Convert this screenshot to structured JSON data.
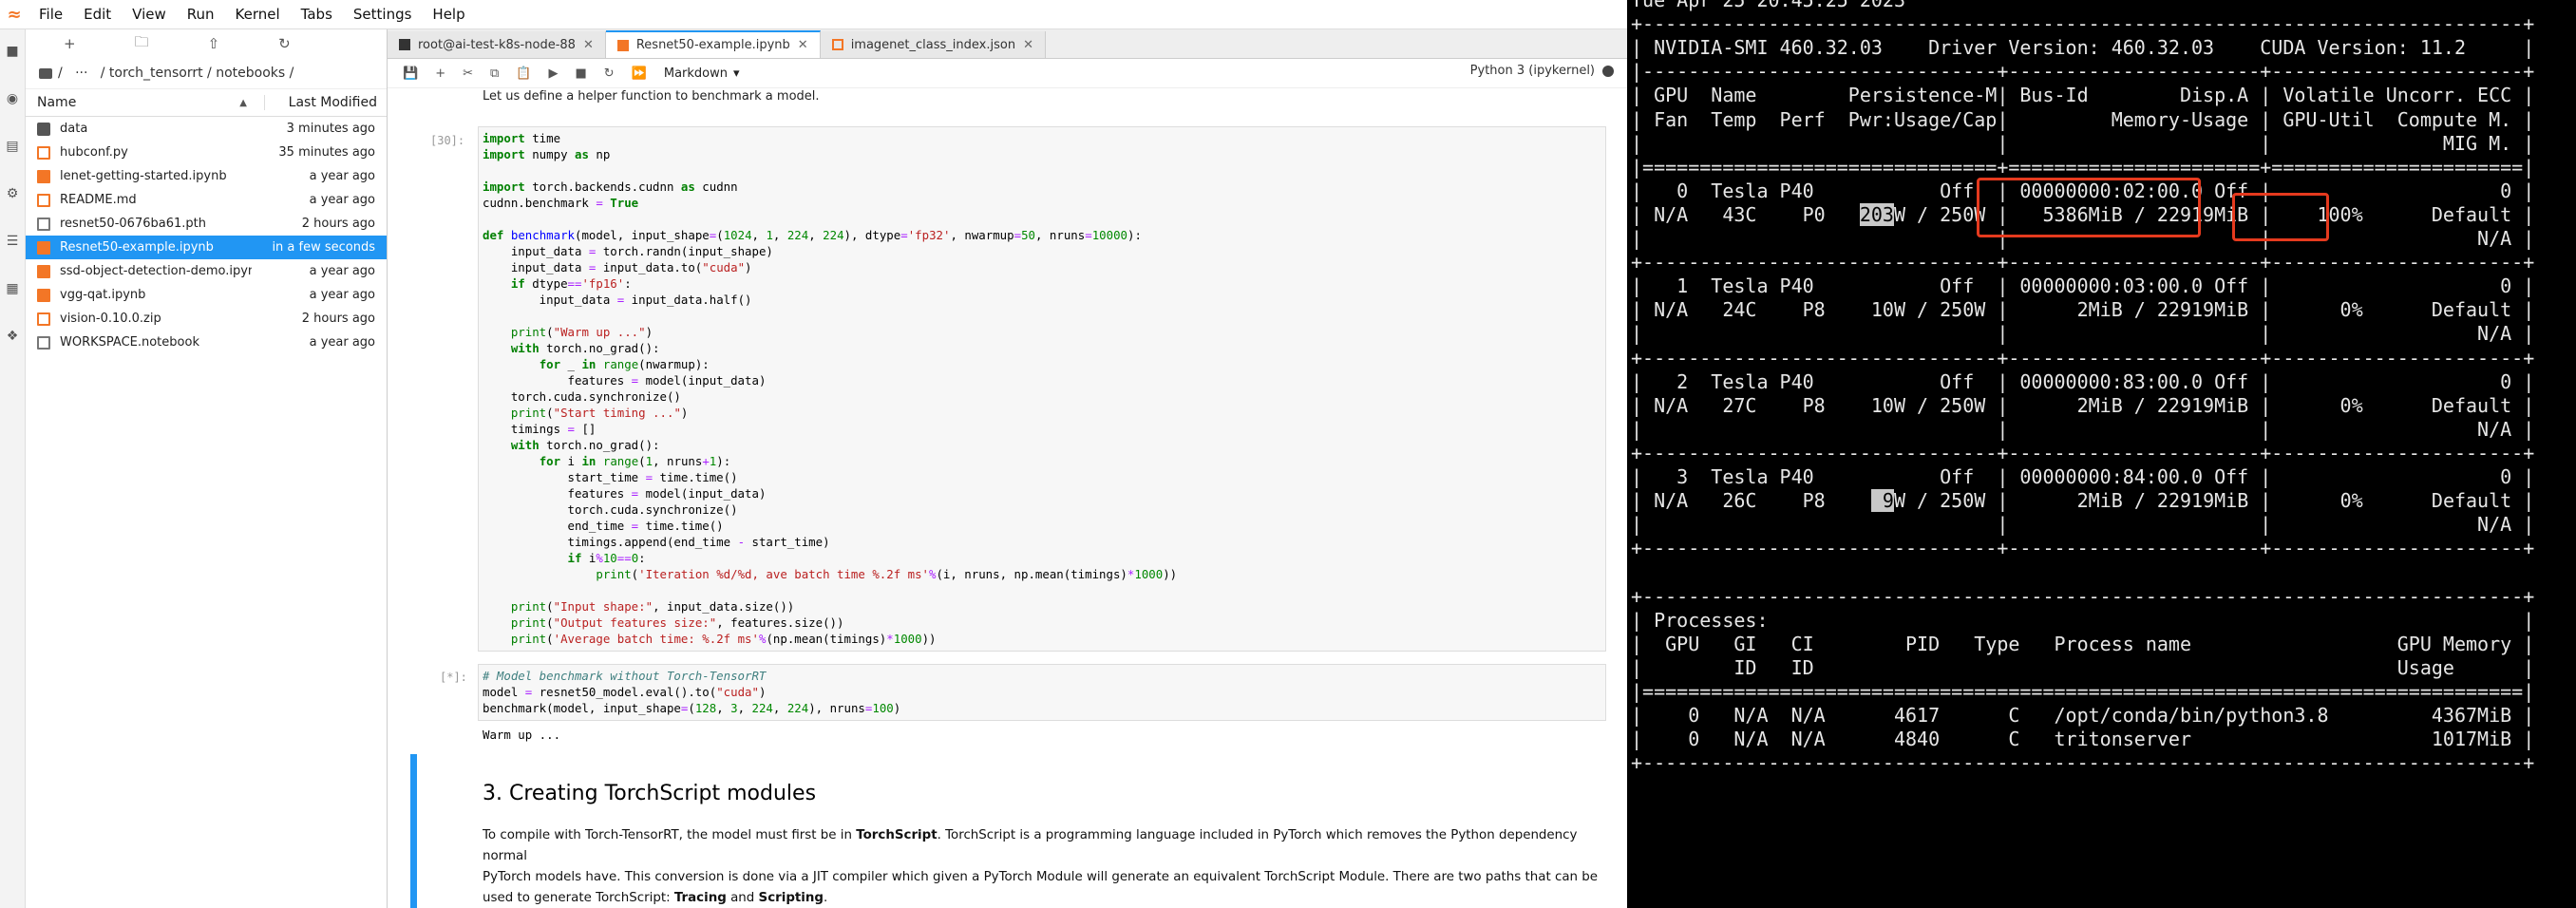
{
  "menubar": {
    "items": [
      "File",
      "Edit",
      "View",
      "Run",
      "Kernel",
      "Tabs",
      "Settings",
      "Help"
    ],
    "clock": "Tue Apr 25 20:45:25 2023"
  },
  "filebrowser": {
    "breadcrumb": "/   ···   / torch_tensorrt / notebooks /",
    "col_name": "Name",
    "col_modified": "Last Modified",
    "files": [
      {
        "name": "data",
        "modified": "3 minutes ago",
        "type": "folder"
      },
      {
        "name": "hubconf.py",
        "modified": "35 minutes ago",
        "type": "py"
      },
      {
        "name": "lenet-getting-started.ipynb",
        "modified": "a year ago",
        "type": "nb"
      },
      {
        "name": "README.md",
        "modified": "a year ago",
        "type": "md"
      },
      {
        "name": "resnet50-0676ba61.pth",
        "modified": "2 hours ago",
        "type": "file"
      },
      {
        "name": "Resnet50-example.ipynb",
        "modified": "in a few seconds",
        "type": "nb",
        "selected": true
      },
      {
        "name": "ssd-object-detection-demo.ipynb",
        "modified": "a year ago",
        "type": "nb"
      },
      {
        "name": "vgg-qat.ipynb",
        "modified": "a year ago",
        "type": "nb"
      },
      {
        "name": "vision-0.10.0.zip",
        "modified": "2 hours ago",
        "type": "zip"
      },
      {
        "name": "WORKSPACE.notebook",
        "modified": "a year ago",
        "type": "file"
      }
    ]
  },
  "tabs": [
    {
      "label": "root@ai-test-k8s-node-88"
    },
    {
      "label": "Resnet50-example.ipynb",
      "active": true
    },
    {
      "label": "imagenet_class_index.json"
    }
  ],
  "toolbar": {
    "cell_type": "Markdown",
    "kernel": "Python 3 (ipykernel)"
  },
  "notebook": {
    "intro_text": "Let us define a helper function to benchmark a model.",
    "cell1_prompt": "[30]:",
    "cell2_prompt": "[*]:",
    "output_text": "Warm up ...",
    "section_title": "3. Creating TorchScript modules",
    "para_1": "To compile with Torch-TensorRT, the model must first be in",
    "para_bold1": "TorchScript",
    "para_2": ". TorchScript is a programming language included in PyTorch which removes the Python dependency normal",
    "para_3": "PyTorch models have. This conversion is done via a JIT compiler which given a PyTorch Module will generate an equivalent TorchScript Module. There are two paths that can be",
    "para_4": "used to generate TorchScript:",
    "para_bold2": "Tracing",
    "para_and": "and",
    "para_bold3": "Scripting",
    "para_end": "."
  },
  "terminal": {
    "lines": [
      "Tue Apr 25 20:45:25 2023",
      "+-----------------------------------------------------------------------------+",
      "| NVIDIA-SMI 460.32.03    Driver Version: 460.32.03    CUDA Version: 11.2     |",
      "|-------------------------------+----------------------+----------------------+",
      "| GPU  Name        Persistence-M| Bus-Id        Disp.A | Volatile Uncorr. ECC |",
      "| Fan  Temp  Perf  Pwr:Usage/Cap|         Memory-Usage | GPU-Util  Compute M. |",
      "|                               |                      |               MIG M. |",
      "|===============================+======================+======================|",
      "|   0  Tesla P40           Off  | 00000000:02:00.0 Off |                    0 |",
      "| N/A   43C    P0   203W / 250W |   5386MiB / 22919MiB |    100%      Default |",
      "|                               |                      |                  N/A |",
      "+-------------------------------+----------------------+----------------------+",
      "|   1  Tesla P40           Off  | 00000000:03:00.0 Off |                    0 |",
      "| N/A   24C    P8    10W / 250W |      2MiB / 22919MiB |      0%      Default |",
      "|                               |                      |                  N/A |",
      "+-------------------------------+----------------------+----------------------+",
      "|   2  Tesla P40           Off  | 00000000:83:00.0 Off |                    0 |",
      "| N/A   27C    P8    10W / 250W |      2MiB / 22919MiB |      0%      Default |",
      "|                               |                      |                  N/A |",
      "+-------------------------------+----------------------+----------------------+",
      "|   3  Tesla P40           Off  | 00000000:84:00.0 Off |                    0 |",
      "| N/A   26C    P8     9W / 250W |      2MiB / 22919MiB |      0%      Default |",
      "|                               |                      |                  N/A |",
      "+-------------------------------+----------------------+----------------------+",
      "",
      "+-----------------------------------------------------------------------------+",
      "| Processes:                                                                  |",
      "|  GPU   GI   CI        PID   Type   Process name                  GPU Memory |",
      "|        ID   ID                                                   Usage      |",
      "|=============================================================================|",
      "|    0   N/A  N/A      4617      C   /opt/conda/bin/python3.8         4367MiB |",
      "|    0   N/A  N/A      4840      C   tritonserver                     1017MiB |",
      "+-----------------------------------------------------------------------------+"
    ]
  }
}
